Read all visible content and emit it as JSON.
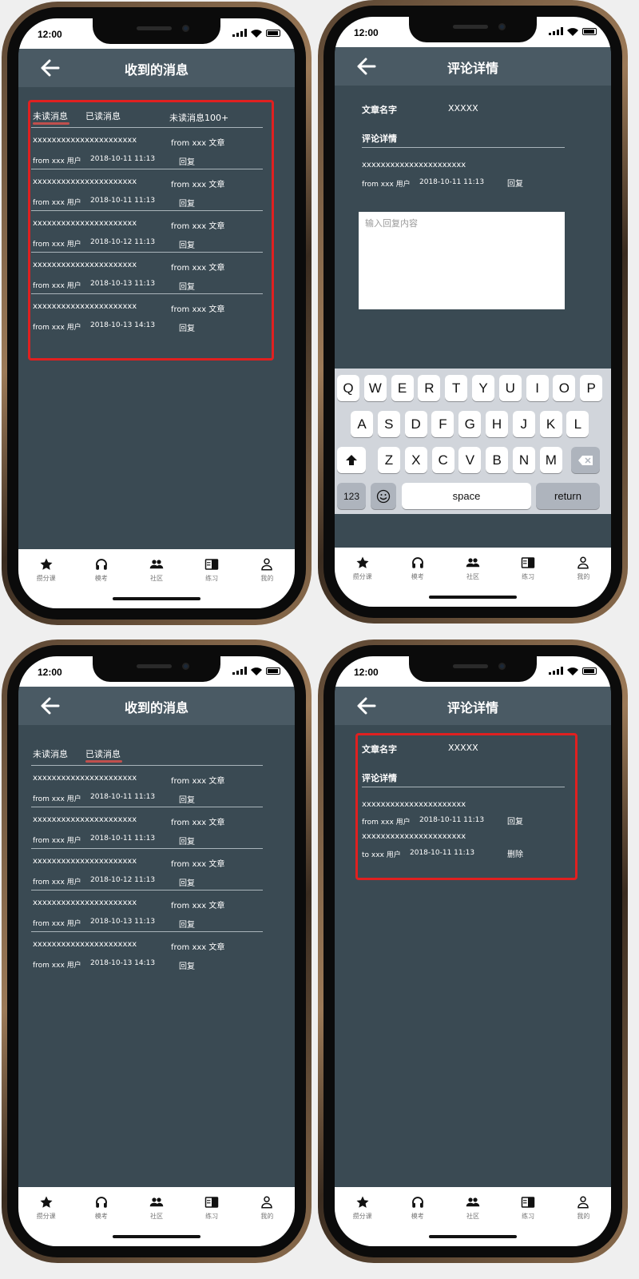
{
  "status_time": "12:00",
  "messages_title": "收到的消息",
  "detail_title": "评论详情",
  "tabs": {
    "unread": "未读消息",
    "read": "已读消息",
    "unread_count": "未读消息100+"
  },
  "messages": [
    {
      "text": "xxxxxxxxxxxxxxxxxxxxxx",
      "from": "from xxx 文章",
      "user": "from xxx 用户",
      "date": "2018-10-11 11:13",
      "reply": "回复"
    },
    {
      "text": "xxxxxxxxxxxxxxxxxxxxxx",
      "from": "from xxx 文章",
      "user": "from xxx 用户",
      "date": "2018-10-11 11:13",
      "reply": "回复"
    },
    {
      "text": "xxxxxxxxxxxxxxxxxxxxxx",
      "from": "from xxx 文章",
      "user": "from xxx 用户",
      "date": "2018-10-12 11:13",
      "reply": "回复"
    },
    {
      "text": "xxxxxxxxxxxxxxxxxxxxxx",
      "from": "from xxx 文章",
      "user": "from xxx 用户",
      "date": "2018-10-13 11:13",
      "reply": "回复"
    },
    {
      "text": "xxxxxxxxxxxxxxxxxxxxxx",
      "from": "from xxx 文章",
      "user": "from xxx 用户",
      "date": "2018-10-13 14:13",
      "reply": "回复"
    }
  ],
  "detail": {
    "article_label": "文章名字",
    "article_name": "XXXXX",
    "section_label": "评论详情",
    "comment_text": "xxxxxxxxxxxxxxxxxxxxxx",
    "comment_user": "from xxx 用户",
    "comment_date": "2018-10-11 11:13",
    "reply_label": "回复",
    "reply_placeholder": "输入回复内容",
    "my_reply_text": "xxxxxxxxxxxxxxxxxxxxxx",
    "my_reply_user": "to xxx 用户",
    "my_reply_date": "2018-10-11 11:13",
    "delete_label": "删除"
  },
  "keyboard": {
    "row1": [
      "Q",
      "W",
      "E",
      "R",
      "T",
      "Y",
      "U",
      "I",
      "O",
      "P"
    ],
    "row2": [
      "A",
      "S",
      "D",
      "F",
      "G",
      "H",
      "J",
      "K",
      "L"
    ],
    "row3": [
      "Z",
      "X",
      "C",
      "V",
      "B",
      "N",
      "M"
    ],
    "num": "123",
    "space": "space",
    "ret": "return"
  },
  "tabbar": [
    {
      "label": "攒分课",
      "icon": "star-icon"
    },
    {
      "label": "模考",
      "icon": "headphones-icon"
    },
    {
      "label": "社区",
      "icon": "people-icon"
    },
    {
      "label": "练习",
      "icon": "book-icon"
    },
    {
      "label": "我的",
      "icon": "person-icon"
    }
  ],
  "colors": {
    "screen_bg": "#3a4a53",
    "navbar": "#4a5a64",
    "highlight": "#e02020",
    "tab_underline": "#c0504d"
  }
}
